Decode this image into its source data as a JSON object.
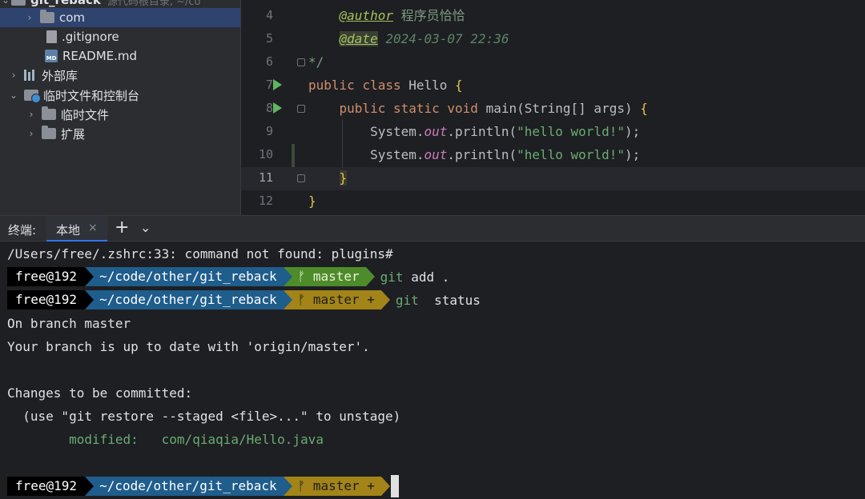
{
  "tree": {
    "root_label": "git_reback",
    "root_hint": "源代码根目录, ~/co",
    "items": [
      {
        "label": "com",
        "type": "folder",
        "expanded": false
      },
      {
        "label": ".gitignore",
        "type": "file"
      },
      {
        "label": "README.md",
        "type": "md",
        "badge": "MD"
      },
      {
        "label": "外部库",
        "type": "library",
        "expanded": false
      },
      {
        "label": "临时文件和控制台",
        "type": "scratch",
        "expanded": true
      },
      {
        "label": "临时文件",
        "type": "folder",
        "expanded": false
      },
      {
        "label": "扩展",
        "type": "folder",
        "expanded": false
      }
    ]
  },
  "editor": {
    "line_numbers": [
      "4",
      "5",
      "6",
      "7",
      "8",
      "9",
      "10",
      "11",
      "12"
    ],
    "current_line": "11",
    "lines": {
      "l4_tag": "@author",
      "l4_text": " 程序员恰恰",
      "l5_tag": "@date",
      "l5_text": " 2024-03-07 22:36",
      "l6": "*/",
      "l7_kw1": "public",
      "l7_kw2": "class",
      "l7_name": " Hello ",
      "l7_brace": "{",
      "l8_kw1": "public",
      "l8_kw2": "static",
      "l8_kw3": "void",
      "l8_sig": " main(String[] args) ",
      "l8_brace": "{",
      "l9_a": "System.",
      "l9_fld": "out",
      "l9_b": ".println(",
      "l9_str": "\"hello world!\"",
      "l9_c": ");",
      "l10_a": "System.",
      "l10_fld": "out",
      "l10_b": ".println(",
      "l10_str": "\"hello world!\"",
      "l10_c": ");",
      "l11_brace": "}",
      "l12_brace": "}"
    }
  },
  "terminal_header": {
    "label": "终端:",
    "tab": "本地",
    "close": "×",
    "plus": "+",
    "chevron": "⌄"
  },
  "terminal": {
    "line1": "/Users/free/.zshrc:33: command not found: plugins#",
    "prompts": [
      {
        "user": "free@192",
        "path": "~/code/other/git_reback",
        "branch": "ᚠ master",
        "dirty_mark": "",
        "cmd": "git",
        "args": " add ."
      },
      {
        "user": "free@192",
        "path": "~/code/other/git_reback",
        "branch": "ᚠ master",
        "dirty_mark": " +",
        "cmd": "git",
        "args": "  status"
      },
      {
        "user": "free@192",
        "path": "~/code/other/git_reback",
        "branch": "ᚠ master",
        "dirty_mark": " +",
        "cmd": "",
        "args": ""
      }
    ],
    "out1": "On branch master",
    "out2": "Your branch is up to date with 'origin/master'.",
    "out3": "Changes to be committed:",
    "out4": "  (use \"git restore --staged <file>...\" to unstage)",
    "out5_label": "        modified:   ",
    "out5_file": "com/qiaqia/Hello.java"
  }
}
